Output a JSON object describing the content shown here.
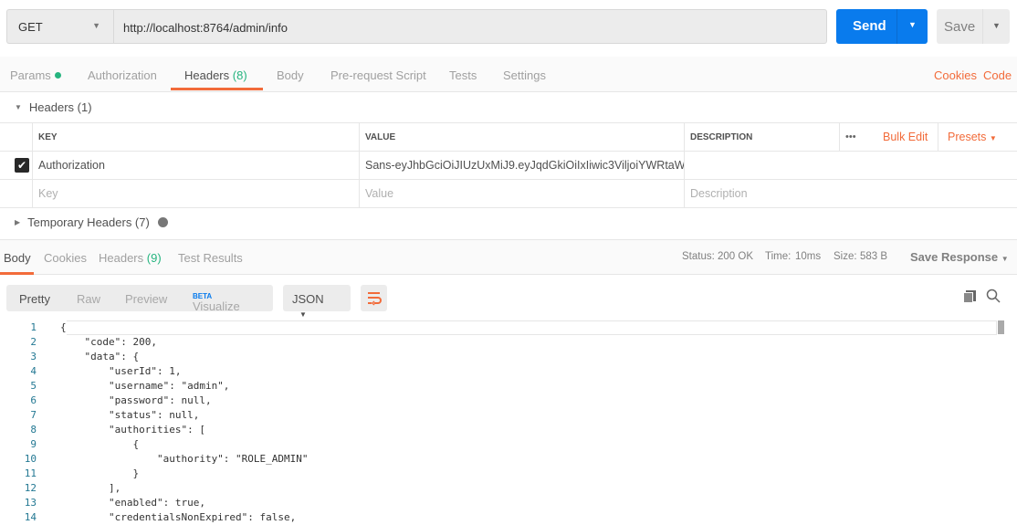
{
  "request": {
    "method": "GET",
    "url": "http://localhost:8764/admin/info",
    "send_label": "Send",
    "save_label": "Save"
  },
  "request_tabs": [
    {
      "label": "Params"
    },
    {
      "label": "Authorization"
    },
    {
      "label": "Headers",
      "count": "(8)"
    },
    {
      "label": "Body"
    },
    {
      "label": "Pre-request Script"
    },
    {
      "label": "Tests"
    },
    {
      "label": "Settings"
    }
  ],
  "links": {
    "cookies": "Cookies",
    "code": "Code"
  },
  "headers_section": {
    "title": "Headers (1)",
    "columns": [
      "KEY",
      "VALUE",
      "DESCRIPTION"
    ],
    "more": "•••",
    "bulk_edit": "Bulk Edit",
    "presets": "Presets",
    "rows": [
      {
        "checked": true,
        "key": "Authorization",
        "value": "Sans-eyJhbGciOiJIUzUxMiJ9.eyJqdGkiOiIxIiwic3ViljoiYWRtaW...",
        "description": ""
      }
    ],
    "placeholder": {
      "key": "Key",
      "value": "Value",
      "description": "Description"
    }
  },
  "temporary_headers": "Temporary Headers (7)",
  "response_tabs": [
    {
      "label": "Body"
    },
    {
      "label": "Cookies"
    },
    {
      "label": "Headers",
      "count": "(9)"
    },
    {
      "label": "Test Results"
    }
  ],
  "status": {
    "status_label": "Status:",
    "status": "200 OK",
    "time_label": "Time:",
    "time": "10ms",
    "size_label": "Size:",
    "size": "583 B",
    "save_response": "Save Response"
  },
  "view_modes": {
    "pretty": "Pretty",
    "raw": "Raw",
    "preview": "Preview",
    "visualize": "Visualize",
    "beta": "BETA",
    "format": "JSON"
  },
  "code_lines": [
    "{",
    "    \"code\": 200,",
    "    \"data\": {",
    "        \"userId\": 1,",
    "        \"username\": \"admin\",",
    "        \"password\": null,",
    "        \"status\": null,",
    "        \"authorities\": [",
    "            {",
    "                \"authority\": \"ROLE_ADMIN\"",
    "            }",
    "        ],",
    "        \"enabled\": true,",
    "        \"credentialsNonExpired\": false,"
  ]
}
